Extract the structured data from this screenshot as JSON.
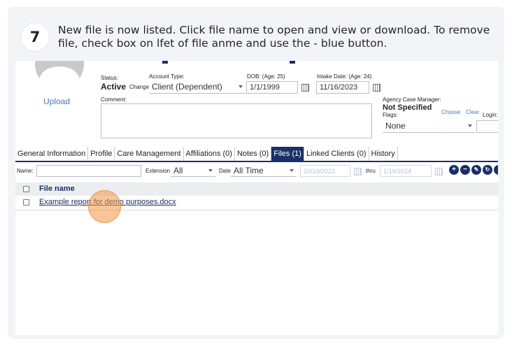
{
  "step": {
    "number": "7",
    "text": "New file is now listed. Click file name to open and view or download. To remove file, check box on lfet of file anme and use the - blue button."
  },
  "profile": {
    "upload_label": "Upload",
    "status_label": "Status:",
    "status_value": "Active",
    "status_change": "Change",
    "account_type_label": "Account Type:",
    "account_type_value": "Client (Dependent)",
    "dob_label": "DOB: (Age: 25)",
    "dob_value": "1/1/1999",
    "intake_label": "Intake Date: (Age: 24)",
    "intake_value": "11/16/2023",
    "comment_label": "Comment:",
    "case_manager_label": "Agency Case Manager:",
    "case_manager_value": "Not Specified",
    "choose_link": "Choose",
    "clear_link": "Clear",
    "flags_label": "Flags:",
    "flags_value": "None",
    "login_label": "Login:"
  },
  "tabs": [
    {
      "label": "General Information"
    },
    {
      "label": "Profile"
    },
    {
      "label": "Care Management"
    },
    {
      "label": "Affiliations (0)"
    },
    {
      "label": "Notes (0)"
    },
    {
      "label": "Files (1)",
      "active": true
    },
    {
      "label": "Linked Clients (0)"
    },
    {
      "label": "History"
    }
  ],
  "filters": {
    "name_label": "Name:",
    "extension_label": "Extension:",
    "extension_value": "All",
    "date_label": "Date:",
    "date_value": "All Time",
    "date_from": "10/19/2023",
    "thru_label": "thru",
    "date_to": "1/19/2024"
  },
  "table": {
    "header": "File name",
    "rows": [
      {
        "file_name": "Example report for demo purposes.docx"
      }
    ]
  },
  "colors": {
    "navy": "#1a2f66",
    "link": "#4a79b3",
    "highlight": "#f0964a"
  }
}
